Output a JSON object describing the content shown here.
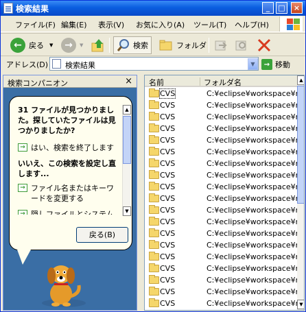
{
  "window": {
    "title": "検索結果"
  },
  "menu": [
    "ファイル(F)",
    "編集(E)",
    "表示(V)",
    "お気に入り(A)",
    "ツール(T)",
    "ヘルプ(H)"
  ],
  "toolbar": {
    "back": "戻る",
    "search": "検索",
    "folders": "フォルダ"
  },
  "address": {
    "label": "アドレス(D)",
    "value": "検索結果",
    "go": "移動"
  },
  "companion": {
    "title": "検索コンパニオン",
    "message": "31 ファイルが見つかりました。探していたファイルは見つかりましたか?",
    "option_done": "はい、検索を終了します",
    "refine_heading": "いいえ、この検索を設定し直します...",
    "option_change_name": "ファイル名またはキーワードを変更する",
    "option_hidden": "隠しファイルとシステム ファイルを含めるかどうかを",
    "back_button": "戻る(B)"
  },
  "results": {
    "columns": [
      "名前",
      "フォルダ名"
    ],
    "rows": [
      {
        "name": "CVS",
        "folder": "C:¥eclipse¥workspace¥n"
      },
      {
        "name": "CVS",
        "folder": "C:¥eclipse¥workspace¥n"
      },
      {
        "name": "CVS",
        "folder": "C:¥eclipse¥workspace¥n"
      },
      {
        "name": "CVS",
        "folder": "C:¥eclipse¥workspace¥n"
      },
      {
        "name": "CVS",
        "folder": "C:¥eclipse¥workspace¥n"
      },
      {
        "name": "CVS",
        "folder": "C:¥eclipse¥workspace¥n"
      },
      {
        "name": "CVS",
        "folder": "C:¥eclipse¥workspace¥n"
      },
      {
        "name": "CVS",
        "folder": "C:¥eclipse¥workspace¥n"
      },
      {
        "name": "CVS",
        "folder": "C:¥eclipse¥workspace¥n"
      },
      {
        "name": "CVS",
        "folder": "C:¥eclipse¥workspace¥n"
      },
      {
        "name": "CVS",
        "folder": "C:¥eclipse¥workspace¥n"
      },
      {
        "name": "CVS",
        "folder": "C:¥eclipse¥workspace¥n"
      },
      {
        "name": "CVS",
        "folder": "C:¥eclipse¥workspace¥n"
      },
      {
        "name": "CVS",
        "folder": "C:¥eclipse¥workspace¥n"
      },
      {
        "name": "CVS",
        "folder": "C:¥eclipse¥workspace¥n"
      },
      {
        "name": "CVS",
        "folder": "C:¥eclipse¥workspace¥n"
      },
      {
        "name": "CVS",
        "folder": "C:¥eclipse¥workspace¥n"
      },
      {
        "name": "CVS",
        "folder": "C:¥eclipse¥workspace¥n"
      },
      {
        "name": "CVS",
        "folder": "C:¥eclipse¥workspace¥n"
      }
    ]
  }
}
